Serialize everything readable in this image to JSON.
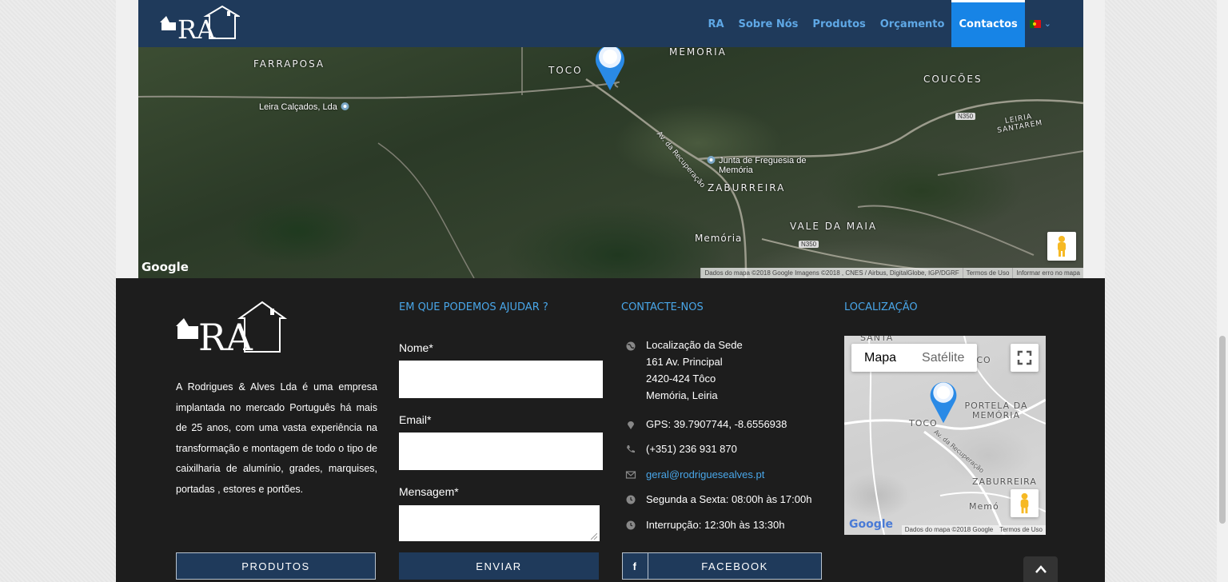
{
  "nav": {
    "items": [
      "RA",
      "Sobre Nós",
      "Produtos",
      "Orçamento",
      "Contactos"
    ],
    "active": "Contactos"
  },
  "logo_text": "RA",
  "satellite_map": {
    "labels": [
      "FARRAPOSA",
      "TOCO",
      "MEMÓRIA",
      "COUCÕES",
      "ZABURREIRA",
      "VALE DA MAIA",
      "Memória"
    ],
    "pois": [
      "Leira Calçados, Lda",
      "Junta de Freguesia de Memória"
    ],
    "road_labels": [
      "Av. da Recuperação",
      "N350",
      "LEIRIA SANTAREM"
    ],
    "google": "Google",
    "attribution": [
      "Dados do mapa ©2018 Google Imagens ©2018 , CNES / Airbus, DigitalGlobe, IGP/DGRF",
      "Termos de Uso",
      "Informar erro no mapa"
    ]
  },
  "footer": {
    "titles": {
      "help": "EM QUE PODEMOS AJUDAR ?",
      "contact": "CONTACTE-NOS",
      "location": "LOCALIZAÇÃO"
    },
    "about": "A Rodrigues & Alves Lda é uma empresa implantada no mercado Português há mais de 25 anos, com uma vasta experiência na transformação e montagem de todo o tipo de caixilharia de alumínio, grades, marquises, portadas , estores e portões.",
    "form": {
      "name_label": "Nome*",
      "email_label": "Email*",
      "message_label": "Mensagem*",
      "submit": "ENVIAR"
    },
    "contact": {
      "address_lines": [
        "Localização da Sede",
        "161 Av. Principal",
        "2420-424 Tôco",
        "Memória, Leiria"
      ],
      "gps": "GPS: 39.7907744, -8.6556938",
      "phone": "(+351) 236 931 870",
      "email": "geral@rodriguesealves.pt",
      "hours": "Segunda a Sexta: 08:00h às 17:00h",
      "break": "Interrupção: 12:30h às 13:30h"
    },
    "buttons": {
      "products": "PRODUTOS",
      "facebook": "FACEBOOK",
      "facebook_icon": "f"
    },
    "mini_map": {
      "map_type": "Mapa",
      "satellite_type": "Satélite",
      "labels": [
        "SANTA",
        "TOCO",
        "PORTELA DA MEMÓRIA",
        "TOCO",
        "Av. da Recuperação",
        "ZABURREIRA",
        "Memó"
      ],
      "google": "Google",
      "attribution": [
        "Dados do mapa ©2018 Google",
        "Termos de Uso"
      ]
    }
  },
  "icons": {
    "flag": "portugal-flag-icon",
    "marker": "map-marker-icon",
    "pegman": "pegman-icon",
    "fullscreen": "fullscreen-icon",
    "globe": "globe-icon",
    "phone": "phone-icon",
    "mail": "mail-icon",
    "clock": "clock-icon",
    "arrow_up": "chevron-up-icon"
  },
  "colors": {
    "header": "#1f3a5b",
    "active": "#1784e6",
    "accent": "#49a6e8",
    "footer": "#1d1d1d"
  }
}
